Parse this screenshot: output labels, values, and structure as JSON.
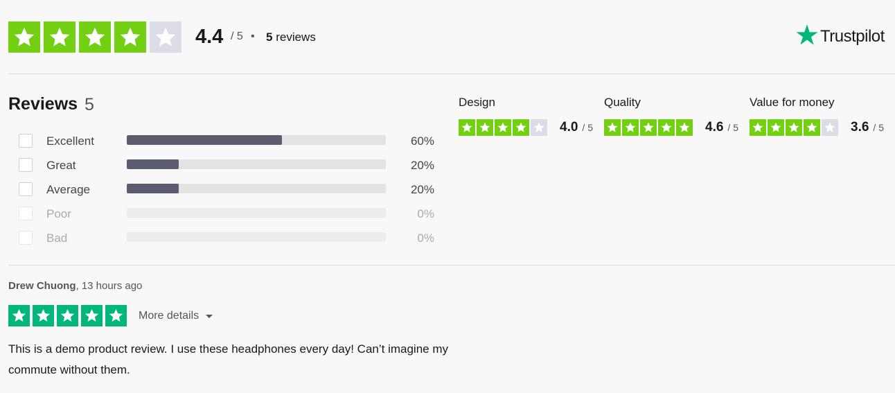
{
  "colors": {
    "star_lime": "#73cf11",
    "star_green": "#00b67a",
    "star_empty": "#dcdce6",
    "bar_fill": "#5b5c70"
  },
  "header": {
    "rating": 4.4,
    "score": "4.4",
    "out_of": "/ 5",
    "dot": "•",
    "review_count": "5",
    "review_word": "reviews",
    "brand": "Trustpilot",
    "brand_icon": "trustpilot-star-icon"
  },
  "summary": {
    "title": "Reviews",
    "count": "5",
    "rows": [
      {
        "label": "Excellent",
        "percent": 60,
        "pct_text": "60%"
      },
      {
        "label": "Great",
        "percent": 20,
        "pct_text": "20%"
      },
      {
        "label": "Average",
        "percent": 20,
        "pct_text": "20%"
      },
      {
        "label": "Poor",
        "percent": 0,
        "pct_text": "0%"
      },
      {
        "label": "Bad",
        "percent": 0,
        "pct_text": "0%"
      }
    ]
  },
  "categories": [
    {
      "name": "Design",
      "rating": 4.0,
      "score": "4.0",
      "out_of": "/ 5"
    },
    {
      "name": "Quality",
      "rating": 4.6,
      "score": "4.6",
      "out_of": "/ 5"
    },
    {
      "name": "Value for money",
      "rating": 3.6,
      "score": "3.6",
      "out_of": "/ 5"
    }
  ],
  "review": {
    "author": "Drew Chuong",
    "time": ", 13 hours ago",
    "rating": 5,
    "more_details": "More details",
    "text": "This is a demo product review. I use these headphones every day! Can’t imagine my commute without them."
  }
}
